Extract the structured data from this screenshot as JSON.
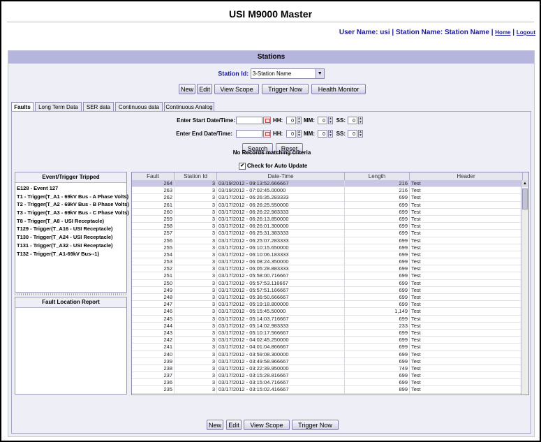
{
  "app": {
    "title": "USI M9000 Master",
    "user_prefix": "User Name: usi | Station Name: Station Name |",
    "home_link": "Home",
    "separator": "|",
    "logout_link": "Logout"
  },
  "panel": {
    "title": "Stations",
    "station_id_label": "Station Id:",
    "station_id_value": "3-Station Name"
  },
  "toolbar_top": {
    "new": "New",
    "edit": "Edit",
    "view_scope": "View Scope",
    "trigger_now": "Trigger Now",
    "health_monitor": "Health Monitor"
  },
  "tabs": [
    {
      "label": "Faults",
      "active": true
    },
    {
      "label": "Long Term Data",
      "active": false
    },
    {
      "label": "SER data",
      "active": false
    },
    {
      "label": "Continuous data",
      "active": false
    },
    {
      "label": "Continuous Analog data",
      "active": false
    }
  ],
  "filter": {
    "start_label": "Enter Start Date/Time:",
    "end_label": "Enter End Date/Time:",
    "hh_label": "HH:",
    "mm_label": "MM:",
    "ss_label": "SS:",
    "start_hh": "0",
    "start_mm": "0",
    "start_ss": "0",
    "end_hh": "0",
    "end_mm": "0",
    "end_ss": "0",
    "search": "Search",
    "reset": "Reset",
    "no_records": "No Records matching criteria",
    "auto_update": "Check for Auto Update",
    "auto_update_checked": true
  },
  "events": {
    "title": "Event/Trigger Tripped",
    "items": [
      "E128 - Event 127",
      "T1 - Trigger(T_A1 - 69kV Bus - A Phase Volts)",
      "T2 - Trigger(T_A2 - 69kV Bus - B Phase Volts)",
      "T3 - Trigger(T_A3 - 69kV Bus - C Phase Volts)",
      "T8 - Trigger(T_A8 - USI Receptacle)",
      "T129 - Trigger(T_A16 - USI Receptacle)",
      "T130 - Trigger(T_A24 - USI Receptacle)",
      "T131 - Trigger(T_A32 - USI Receptacle)",
      "T132 - Trigger(T_A1-69kV Bus--1)"
    ]
  },
  "fault_location": {
    "title": "Fault Location Report"
  },
  "grid": {
    "columns": [
      "Fault",
      "Station Id",
      "Date-Time",
      "Length",
      "Header"
    ],
    "rows": [
      [
        "264",
        "3",
        "03/19/2012 - 09:13:52.666667",
        "216",
        "Test"
      ],
      [
        "263",
        "3",
        "03/19/2012 - 07:02:45.00000",
        "216",
        "Test"
      ],
      [
        "262",
        "3",
        "03/17/2012 - 06:26:35.283333",
        "699",
        "Test"
      ],
      [
        "261",
        "3",
        "03/17/2012 - 06:26:25.550000",
        "699",
        "Test"
      ],
      [
        "260",
        "3",
        "03/17/2012 - 06:26:22.983333",
        "699",
        "Test"
      ],
      [
        "259",
        "3",
        "03/17/2012 - 06:26:13.850000",
        "699",
        "Test"
      ],
      [
        "258",
        "3",
        "03/17/2012 - 06:26:01.300000",
        "699",
        "Test"
      ],
      [
        "257",
        "3",
        "03/17/2012 - 06:25:31.383333",
        "699",
        "Test"
      ],
      [
        "256",
        "3",
        "03/17/2012 - 06:25:07.283333",
        "699",
        "Test"
      ],
      [
        "255",
        "3",
        "03/17/2012 - 06:10:15.650000",
        "699",
        "Test"
      ],
      [
        "254",
        "3",
        "03/17/2012 - 06:10:06.183333",
        "699",
        "Test"
      ],
      [
        "253",
        "3",
        "03/17/2012 - 06:08:24.350000",
        "699",
        "Test"
      ],
      [
        "252",
        "3",
        "03/17/2012 - 06:05:28.883333",
        "699",
        "Test"
      ],
      [
        "251",
        "3",
        "03/17/2012 - 05:58:00.716667",
        "699",
        "Test"
      ],
      [
        "250",
        "3",
        "03/17/2012 - 05:57:53.116667",
        "699",
        "Test"
      ],
      [
        "249",
        "3",
        "03/17/2012 - 05:57:51.166667",
        "699",
        "Test"
      ],
      [
        "248",
        "3",
        "03/17/2012 - 05:36:50.666667",
        "699",
        "Test"
      ],
      [
        "247",
        "3",
        "03/17/2012 - 05:19:18.800000",
        "699",
        "Test"
      ],
      [
        "246",
        "3",
        "03/17/2012 - 05:15:45.50000",
        "1,149",
        "Test"
      ],
      [
        "245",
        "3",
        "03/17/2012 - 05:14:03.716667",
        "699",
        "Test"
      ],
      [
        "244",
        "3",
        "03/17/2012 - 05:14:02.983333",
        "233",
        "Test"
      ],
      [
        "243",
        "3",
        "03/17/2012 - 05:10:17.566667",
        "699",
        "Test"
      ],
      [
        "242",
        "3",
        "03/17/2012 - 04:02:45.250000",
        "699",
        "Test"
      ],
      [
        "241",
        "3",
        "03/17/2012 - 04:01:04.866667",
        "699",
        "Test"
      ],
      [
        "240",
        "3",
        "03/17/2012 - 03:59:08.300000",
        "699",
        "Test"
      ],
      [
        "239",
        "3",
        "03/17/2012 - 03:49:58.966667",
        "699",
        "Test"
      ],
      [
        "238",
        "3",
        "03/17/2012 - 03:22:39.950000",
        "749",
        "Test"
      ],
      [
        "237",
        "3",
        "03/17/2012 - 03:15:28.816667",
        "699",
        "Test"
      ],
      [
        "236",
        "3",
        "03/17/2012 - 03:15:04.716667",
        "699",
        "Test"
      ],
      [
        "235",
        "3",
        "03/17/2012 - 03:15:02.416667",
        "899",
        "Test"
      ]
    ]
  },
  "toolbar_bottom": {
    "new": "New",
    "edit": "Edit",
    "view_scope": "View Scope",
    "trigger_now": "Trigger Now"
  }
}
